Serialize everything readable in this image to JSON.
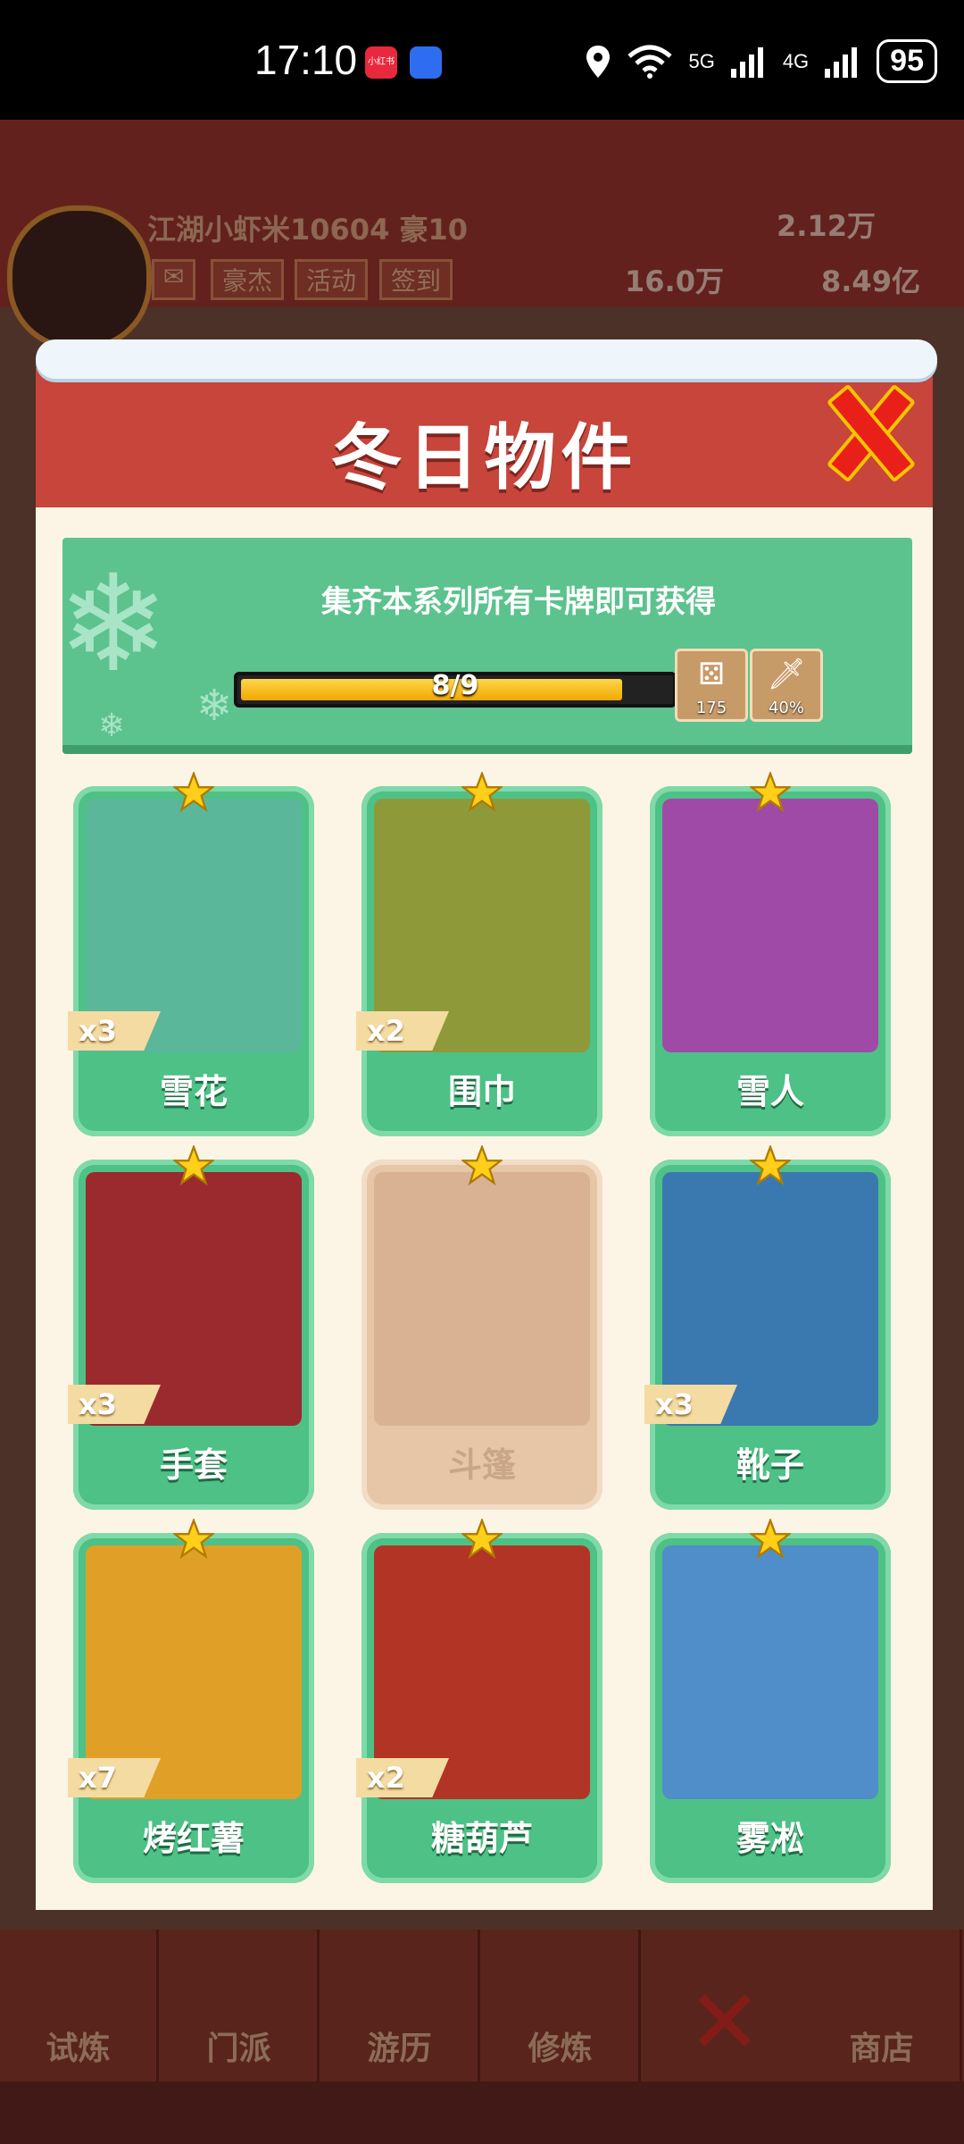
{
  "status_bar": {
    "time": "17:10",
    "app_icon_1": "小红书",
    "network_5g": "5G",
    "network_4g": "4G",
    "battery": "95"
  },
  "player": {
    "name": "江湖小虾米10604",
    "vip": "豪10",
    "buttons": [
      "豪杰",
      "活动",
      "签到"
    ],
    "gems": "2.12万",
    "power": "16.0万",
    "coins": "8.49亿"
  },
  "modal": {
    "title": "冬日物件",
    "banner_text": "集齐本系列所有卡牌即可获得",
    "progress_text": "8/9",
    "progress_fraction": 0.889,
    "rewards": [
      {
        "icon": "dice-icon",
        "value": "175"
      },
      {
        "icon": "sword-icon",
        "value": "40%"
      }
    ],
    "cards": [
      {
        "name": "雪花",
        "count": "x3",
        "owned": true,
        "art_bg": "#5bb79a"
      },
      {
        "name": "围巾",
        "count": "x2",
        "owned": true,
        "art_bg": "#8e9a3a"
      },
      {
        "name": "雪人",
        "count": "",
        "owned": true,
        "art_bg": "#a04aa8"
      },
      {
        "name": "手套",
        "count": "x3",
        "owned": true,
        "art_bg": "#9a2a2e"
      },
      {
        "name": "斗篷",
        "count": "",
        "owned": false,
        "art_bg": "#d9b294"
      },
      {
        "name": "靴子",
        "count": "x3",
        "owned": true,
        "art_bg": "#3a79b0"
      },
      {
        "name": "烤红薯",
        "count": "x7",
        "owned": true,
        "art_bg": "#e0a028"
      },
      {
        "name": "糖葫芦",
        "count": "x2",
        "owned": true,
        "art_bg": "#b23424"
      },
      {
        "name": "雾凇",
        "count": "",
        "owned": true,
        "art_bg": "#4f8ec8"
      }
    ]
  },
  "bottom_nav": [
    "试炼",
    "门派",
    "游历",
    "修炼",
    "",
    "商店"
  ],
  "colors": {
    "header_red": "#c7453b",
    "card_green": "#4dc186",
    "close_red": "#e9201a",
    "progress_yellow": "#ffd54a"
  }
}
